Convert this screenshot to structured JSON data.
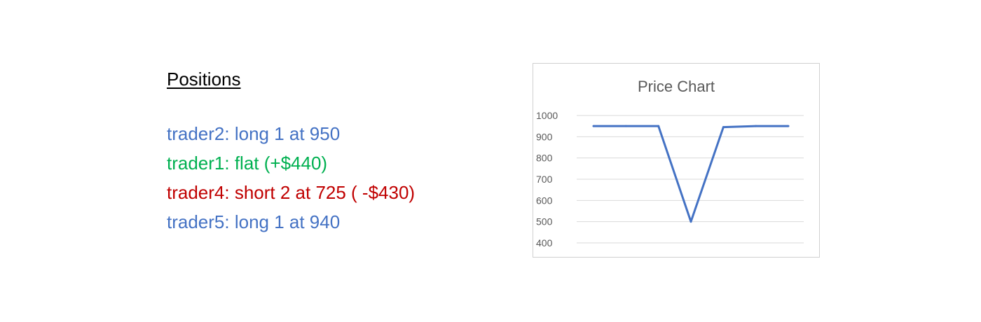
{
  "positions": {
    "heading": "Positions",
    "lines": [
      {
        "text": "trader2: long 1 at 950",
        "color": "#4472C4"
      },
      {
        "text": "trader1: flat (+$440)",
        "color": "#00B050"
      },
      {
        "text": "trader4: short 2 at 725 ( -$430)",
        "color": "#C00000"
      },
      {
        "text": "trader5: long 1 at 940",
        "color": "#4472C4"
      }
    ]
  },
  "chart_data": {
    "type": "line",
    "title": "Price Chart",
    "xlabel": "",
    "ylabel": "",
    "ylim": [
      400,
      1000
    ],
    "yticks": [
      "1000",
      "900",
      "800",
      "700",
      "600",
      "500",
      "400"
    ],
    "grid": true,
    "legend": "none",
    "x": [
      1,
      2,
      3,
      4,
      5,
      6,
      7
    ],
    "series": [
      {
        "color": "#4472C4",
        "values": [
          950,
          950,
          950,
          500,
          945,
          950,
          950
        ]
      }
    ]
  }
}
